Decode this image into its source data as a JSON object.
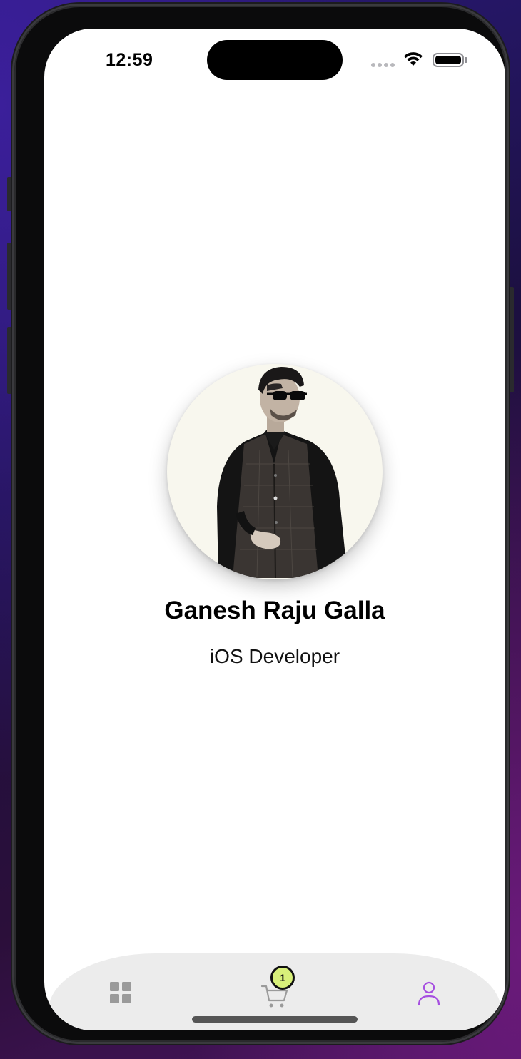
{
  "status_bar": {
    "time": "12:59"
  },
  "profile": {
    "name": "Ganesh Raju Galla",
    "title": "iOS Developer",
    "avatar_icon": "profile-photo"
  },
  "tab_bar": {
    "items": [
      {
        "icon": "grid-icon",
        "selected": false
      },
      {
        "icon": "cart-icon",
        "selected": false,
        "badge": "1"
      },
      {
        "icon": "person-icon",
        "selected": true
      }
    ],
    "selected_color": "#a64fe0",
    "unselected_color": "#9a9a9a",
    "badge_color": "#d8f07a"
  },
  "colors": {
    "screen_background": "#ffffff",
    "tab_bar_background": "#ececec"
  }
}
